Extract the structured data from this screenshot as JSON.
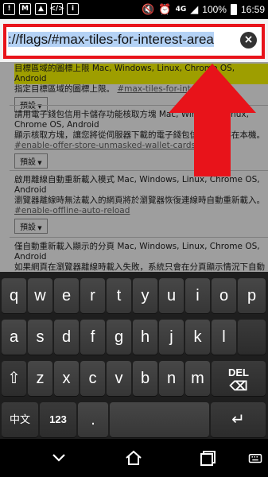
{
  "status_bar": {
    "battery": "100%",
    "time": "16:59",
    "network": "4G",
    "left_icons": [
      "warning-icon",
      "gmail-icon",
      "image-icon",
      "code-icon",
      "info-icon"
    ]
  },
  "url_bar": {
    "value": "://flags/#max-tiles-for-interest-area"
  },
  "flags": [
    {
      "title": "目標區域的圖標上限 Mac, Windows, Linux, Chrome OS, Android",
      "desc": "指定目標區域的圖標上限。",
      "link": "#max-tiles-for-interest-area",
      "select": "預設"
    },
    {
      "title": "請用電子錢包信用卡儲存功能核取方塊 Mac, Windows, Linux, Chrome OS, Android",
      "desc": "顯示核取方塊，讓您將從伺服器下載的電子錢包信用卡儲存在本機。",
      "link": "#enable-offer-store-unmasked-wallet-cards",
      "select": "預設"
    },
    {
      "title": "啟用離線自動重新載入模式 Mac, Windows, Linux, Chrome OS, Android",
      "desc": "瀏覽器離線時無法載入的網頁將於瀏覽器恢復連線時自動重新載入。",
      "link": "#enable-offline-auto-reload",
      "select": "預設"
    },
    {
      "title": "僅自動重新載入顯示的分頁 Mac, Windows, Linux, Chrome OS, Android",
      "desc": "如果網頁在瀏覽器離線時載入失敗，系統只會在分頁顯示情況下自動重新載入網頁。"
    }
  ],
  "keyboard": {
    "row1": [
      "q",
      "w",
      "e",
      "r",
      "t",
      "y",
      "u",
      "i",
      "o",
      "p"
    ],
    "row2": [
      "a",
      "s",
      "d",
      "f",
      "g",
      "h",
      "j",
      "k",
      "l"
    ],
    "row3": [
      "z",
      "x",
      "c",
      "v",
      "b",
      "n",
      "m"
    ],
    "shift_label": "⇧",
    "del_label": "DEL",
    "lang_label": "中文",
    "num_label": "123",
    "period_label": ".",
    "enter_label": "↵"
  },
  "colors": {
    "accent_red": "#e8131a",
    "highlight": "#b4d2f5"
  }
}
